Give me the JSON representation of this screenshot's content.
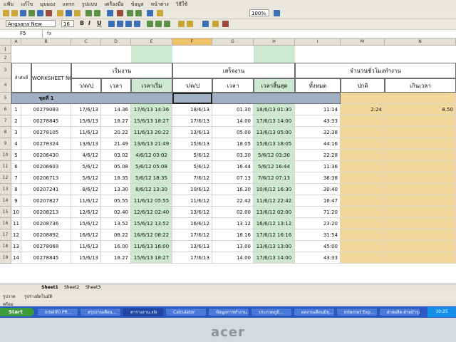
{
  "menu": [
    "แฟ้ม",
    "แก้ไข",
    "มุมมอง",
    "แทรก",
    "รูปแบบ",
    "เครื่องมือ",
    "ข้อมูล",
    "หน้าต่าง",
    "วิธีใช้"
  ],
  "toolbar": {
    "font_name": "Angsana New",
    "font_size": "16",
    "zoom": "100%",
    "bold": "B",
    "italic": "I",
    "underline": "U"
  },
  "formula": {
    "cell_ref": "F5",
    "fx": "fx"
  },
  "columns": [
    "A",
    "B",
    "C",
    "D",
    "E",
    "F",
    "G",
    "H",
    "I",
    "M",
    "N"
  ],
  "rows": [
    "1",
    "2",
    "3",
    "4",
    "5",
    "6",
    "7",
    "8",
    "9",
    "10",
    "11",
    "12",
    "13",
    "14",
    "15",
    "16",
    "17",
    "18",
    "19"
  ],
  "headers": {
    "seq": "ลำดับที่",
    "ws": "WORKSHEET NO.",
    "start": "เริ่มงาน",
    "start_date": "ว/ด/ป",
    "start_time": "เวลา",
    "start_dt": "เวลาเริ่ม",
    "finish": "เสร็จงาน",
    "finish_date": "ว/ด/ป",
    "finish_time": "เวลา",
    "finish_dt": "เวลาสิ้นสุด",
    "hours": "จำนวนชั่วโมงทำงาน",
    "total": "ทั้งหมด",
    "normal": "ปกติ",
    "over": "เกินเวลา",
    "group": "ชุดที่ 1"
  },
  "data": [
    {
      "n": "1",
      "ws": "00279093",
      "sd": "17/6/13",
      "st": "14.36",
      "sdt": "17/6/13 14:36",
      "fd": "18/6/13",
      "ft": "01.30",
      "fdt": "18/6/13 01:30",
      "tot": "11:14",
      "nrm": "2:24",
      "ovr": "8.50"
    },
    {
      "n": "2",
      "ws": "00278845",
      "sd": "15/6/13",
      "st": "18.27",
      "sdt": "15/6/13 18:27",
      "fd": "17/6/13",
      "ft": "14.00",
      "fdt": "17/6/13 14:00",
      "tot": "43:33",
      "nrm": "",
      "ovr": ""
    },
    {
      "n": "3",
      "ws": "00278105",
      "sd": "11/6/13",
      "st": "20.22",
      "sdt": "11/6/13 20:22",
      "fd": "13/6/13",
      "ft": "05.00",
      "fdt": "13/6/13 05:00",
      "tot": "32:38",
      "nrm": "",
      "ovr": ""
    },
    {
      "n": "4",
      "ws": "00278324",
      "sd": "13/6/13",
      "st": "21.49",
      "sdt": "13/6/13 21:49",
      "fd": "15/6/13",
      "ft": "18.05",
      "fdt": "15/6/13 18:05",
      "tot": "44:16",
      "nrm": "",
      "ovr": ""
    },
    {
      "n": "5",
      "ws": "00206430",
      "sd": "4/6/12",
      "st": "03.02",
      "sdt": "4/6/12 03:02",
      "fd": "5/6/12",
      "ft": "03.30",
      "fdt": "5/6/12 03:30",
      "tot": "22:28",
      "nrm": "",
      "ovr": ""
    },
    {
      "n": "6",
      "ws": "00206603",
      "sd": "5/6/12",
      "st": "05.08",
      "sdt": "5/6/12 05:08",
      "fd": "5/6/12",
      "ft": "16.44",
      "fdt": "5/6/12 16:44",
      "tot": "11:36",
      "nrm": "",
      "ovr": ""
    },
    {
      "n": "7",
      "ws": "00206713",
      "sd": "5/6/12",
      "st": "18.35",
      "sdt": "5/6/12 18:35",
      "fd": "7/6/12",
      "ft": "07.13",
      "fdt": "7/6/12 07:13",
      "tot": "36:38",
      "nrm": "",
      "ovr": ""
    },
    {
      "n": "8",
      "ws": "00207241",
      "sd": "8/6/12",
      "st": "13.30",
      "sdt": "8/6/12 13:30",
      "fd": "10/6/12",
      "ft": "16.30",
      "fdt": "10/6/12 16:30",
      "tot": "30:40",
      "nrm": "",
      "ovr": ""
    },
    {
      "n": "9",
      "ws": "00207827",
      "sd": "11/6/12",
      "st": "05.55",
      "sdt": "11/6/12 05:55",
      "fd": "11/6/12",
      "ft": "22.42",
      "fdt": "11/6/12 22:42",
      "tot": "16:47",
      "nrm": "",
      "ovr": ""
    },
    {
      "n": "10",
      "ws": "00208213",
      "sd": "12/6/12",
      "st": "02.40",
      "sdt": "12/6/12 02:40",
      "fd": "13/6/12",
      "ft": "02.00",
      "fdt": "13/6/12 02:00",
      "tot": "71:20",
      "nrm": "",
      "ovr": ""
    },
    {
      "n": "11",
      "ws": "00208736",
      "sd": "15/6/12",
      "st": "13.52",
      "sdt": "15/6/12 13:52",
      "fd": "16/6/12",
      "ft": "13.12",
      "fdt": "16/6/12 13:12",
      "tot": "23:20",
      "nrm": "",
      "ovr": ""
    },
    {
      "n": "12",
      "ws": "00208892",
      "sd": "16/6/12",
      "st": "08.22",
      "sdt": "16/6/12 08:22",
      "fd": "17/6/12",
      "ft": "16.16",
      "fdt": "17/6/12 16:16",
      "tot": "31:54",
      "nrm": "",
      "ovr": ""
    },
    {
      "n": "13",
      "ws": "00278068",
      "sd": "11/6/13",
      "st": "16.00",
      "sdt": "11/6/13 16:00",
      "fd": "13/6/13",
      "ft": "13.00",
      "fdt": "13/6/13 13:00",
      "tot": "45:00",
      "nrm": "",
      "ovr": ""
    },
    {
      "n": "14",
      "ws": "00278845",
      "sd": "15/6/13",
      "st": "18.27",
      "sdt": "15/6/13 18:27",
      "fd": "17/6/13",
      "ft": "14.00",
      "fdt": "17/6/13 14:00",
      "tot": "43:33",
      "nrm": "",
      "ovr": ""
    }
  ],
  "sheets": [
    "Sheet1",
    "Sheet2",
    "Sheet3"
  ],
  "draw_bar": {
    "draw": "รูปวาด",
    "autoshapes": "รูปร่างอัตโนมัติ"
  },
  "status": "พร้อม",
  "taskbar": {
    "start": "Start",
    "items": [
      "Intel(R) PR...",
      "สรุปงานเดือน...",
      "ตารางงาน.xls",
      "Calculator",
      "ข้อมูลการทำงาน...",
      "ประกวดภูมิ...",
      "ผลงานเดือนมิถุ...",
      "Internet Exp...",
      "ฝ่ายผลิต ฝ่ายบำรุง"
    ],
    "clock": "10:25"
  },
  "brand": "acer"
}
